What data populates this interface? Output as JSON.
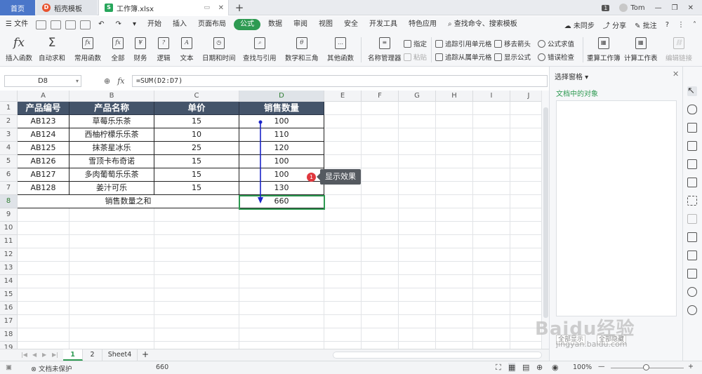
{
  "titlebar": {
    "tabs": [
      {
        "label": "首页"
      },
      {
        "label": "稻壳模板"
      },
      {
        "label": "工作簿.xlsx"
      }
    ],
    "new_tab": "+",
    "window_count": "1",
    "user": "Tom"
  },
  "menubar": {
    "file": "文件",
    "items": [
      "开始",
      "插入",
      "页面布局",
      "公式",
      "数据",
      "审阅",
      "视图",
      "安全",
      "开发工具",
      "特色应用"
    ],
    "active": "公式",
    "search": "查找命令、搜索模板",
    "right": {
      "sync": "未同步",
      "share": "分享",
      "annotate": "批注"
    }
  },
  "ribbon": {
    "insert_function": "插入函数",
    "autosum": "自动求和",
    "common_functions": "常用函数",
    "all": "全部",
    "financial": "财务",
    "logical": "逻辑",
    "text": "文本",
    "datetime": "日期和时间",
    "lookup": "查找与引用",
    "math": "数学和三角",
    "other": "其他函数",
    "name_manager": "名称管理器",
    "specify": "指定",
    "paste": "粘贴",
    "trace_precedents": "追踪引用单元格",
    "trace_dependents": "追踪从属单元格",
    "remove_arrows": "移去箭头",
    "show_formulas": "显示公式",
    "formula_evaluate": "公式求值",
    "error_check": "错误检查",
    "recalc": "重算工作簿",
    "calc_sheet": "计算工作表",
    "edit_links": "编辑链接"
  },
  "formula_bar": {
    "name_box": "D8",
    "fx": "fx",
    "formula": "=SUM(D2:D7)"
  },
  "grid": {
    "columns": [
      "A",
      "B",
      "C",
      "D",
      "E",
      "F",
      "G",
      "H",
      "I",
      "J"
    ],
    "rows": [
      "1",
      "2",
      "3",
      "4",
      "5",
      "6",
      "7",
      "8",
      "9",
      "10",
      "11",
      "12",
      "13",
      "14",
      "15",
      "16",
      "17",
      "18",
      "19"
    ],
    "header": [
      "产品编号",
      "产品名称",
      "单价",
      "销售数量"
    ],
    "data": [
      [
        "AB123",
        "草莓乐乐茶",
        "15",
        "100"
      ],
      [
        "AB124",
        "西柚柠檬乐乐茶",
        "10",
        "110"
      ],
      [
        "AB125",
        "抹茶星冰乐",
        "25",
        "120"
      ],
      [
        "AB126",
        "雪顶卡布奇诺",
        "15",
        "100"
      ],
      [
        "AB127",
        "多肉葡萄乐乐茶",
        "15",
        "100"
      ],
      [
        "AB128",
        "姜汁可乐",
        "15",
        "130"
      ]
    ],
    "total_label": "销售数量之和",
    "total_value": "660",
    "selected_cell": "D8"
  },
  "callout": {
    "number": "1",
    "text": "显示效果"
  },
  "sheets": {
    "tabs": [
      "1",
      "2",
      "Sheet4"
    ],
    "active": "1",
    "add": "+"
  },
  "status": {
    "protect": "文档未保护",
    "sum": "660",
    "zoom": "100%"
  },
  "pane": {
    "title": "选择窗格",
    "subtitle": "文档中的对象",
    "show_all": "全部显示",
    "hide_all": "全部隐藏"
  },
  "watermark": {
    "brand": "Baidu经验",
    "url": "jingyan.baidu.com"
  },
  "colors": {
    "accent": "#2e9a52",
    "header_fill": "#44546a",
    "arrow": "#1a24c8",
    "callout_badge": "#e0383e"
  }
}
